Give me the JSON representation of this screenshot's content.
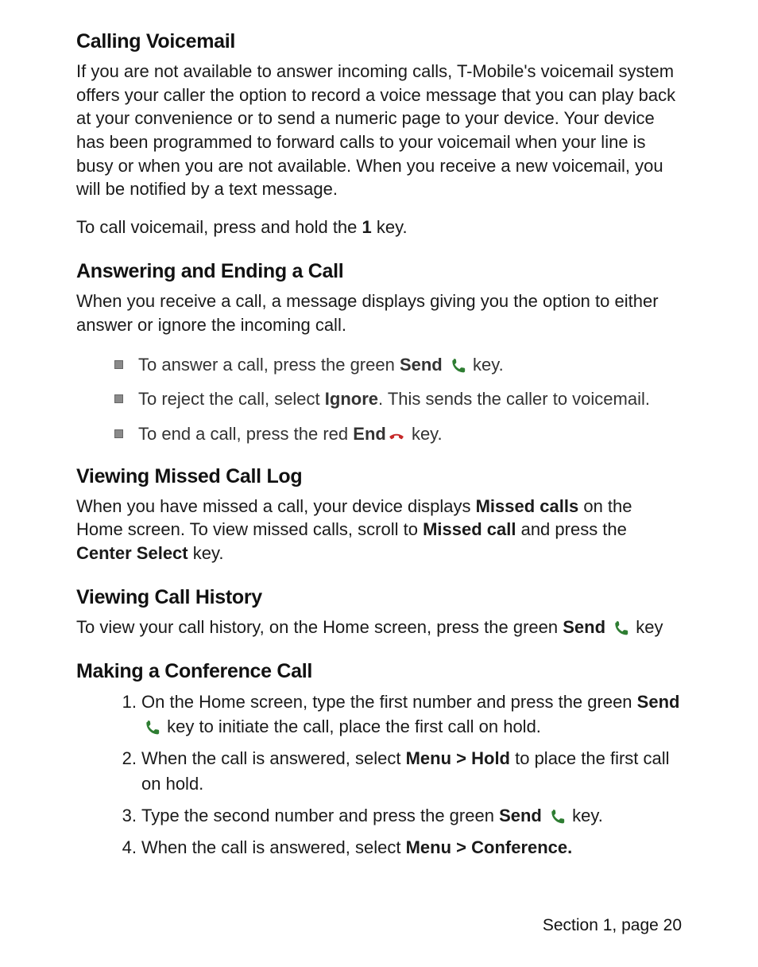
{
  "sections": {
    "voicemail": {
      "heading": "Calling Voicemail",
      "para1": "If you are not available to answer incoming calls, T-Mobile's voicemail system offers your caller the option to record a voice message that you can play back at your convenience or to send a numeric page to your device. Your device has been programmed to forward calls to your voicemail when your line is busy or when you are not available. When you receive a new voicemail, you will be notified by a text message.",
      "para2_pre": "To call voicemail, press and hold the ",
      "para2_key": "1",
      "para2_post": " key."
    },
    "answering": {
      "heading": "Answering and Ending a Call",
      "para": "When you receive a call, a message displays giving you the option to either answer or ignore the incoming call.",
      "b1_pre": "To answer a call, press the green ",
      "b1_key": "Send",
      "b1_post": " key.",
      "b2_pre": "To reject the call, select ",
      "b2_key": "Ignore",
      "b2_post": ". This sends the caller to voicemail.",
      "b3_pre": "To end a call, press the red ",
      "b3_key": "End",
      "b3_post": " key."
    },
    "missed": {
      "heading": "Viewing Missed Call Log",
      "p_pre": "When you have missed a call, your device displays ",
      "p_k1": "Missed calls",
      "p_mid1": " on the Home screen. To view missed calls, scroll to ",
      "p_k2": "Missed call",
      "p_mid2": " and press the ",
      "p_k3": "Center Select",
      "p_post": " key."
    },
    "history": {
      "heading": "Viewing Call History",
      "p_pre": "To view your call history, on the Home screen, press the green ",
      "p_key": "Send",
      "p_post": " key"
    },
    "conference": {
      "heading": "Making a Conference Call",
      "s1_pre": "On the Home screen, type the first number and press the green ",
      "s1_key": "Send",
      "s1_post": " key to initiate the call, place the first call on hold.",
      "s2_pre": "When the call is answered, select ",
      "s2_key": "Menu > Hold",
      "s2_post": " to place the first call on hold.",
      "s3_pre": "Type the second number and press the green ",
      "s3_key": "Send",
      "s3_post": " key.",
      "s4_pre": "When the call is answered, select ",
      "s4_key": "Menu > Conference."
    }
  },
  "footer": "Section 1, page 20",
  "icons": {
    "send": "send-phone-icon",
    "end": "end-phone-icon"
  }
}
